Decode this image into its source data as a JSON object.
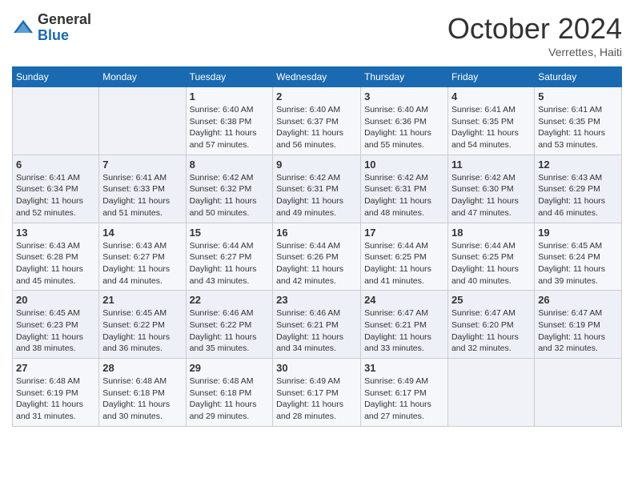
{
  "header": {
    "logo_line1": "General",
    "logo_line2": "Blue",
    "month_year": "October 2024",
    "location": "Verrettes, Haiti"
  },
  "days_of_week": [
    "Sunday",
    "Monday",
    "Tuesday",
    "Wednesday",
    "Thursday",
    "Friday",
    "Saturday"
  ],
  "weeks": [
    [
      {
        "day": "",
        "detail": ""
      },
      {
        "day": "",
        "detail": ""
      },
      {
        "day": "1",
        "detail": "Sunrise: 6:40 AM\nSunset: 6:38 PM\nDaylight: 11 hours\nand 57 minutes."
      },
      {
        "day": "2",
        "detail": "Sunrise: 6:40 AM\nSunset: 6:37 PM\nDaylight: 11 hours\nand 56 minutes."
      },
      {
        "day": "3",
        "detail": "Sunrise: 6:40 AM\nSunset: 6:36 PM\nDaylight: 11 hours\nand 55 minutes."
      },
      {
        "day": "4",
        "detail": "Sunrise: 6:41 AM\nSunset: 6:35 PM\nDaylight: 11 hours\nand 54 minutes."
      },
      {
        "day": "5",
        "detail": "Sunrise: 6:41 AM\nSunset: 6:35 PM\nDaylight: 11 hours\nand 53 minutes."
      }
    ],
    [
      {
        "day": "6",
        "detail": "Sunrise: 6:41 AM\nSunset: 6:34 PM\nDaylight: 11 hours\nand 52 minutes."
      },
      {
        "day": "7",
        "detail": "Sunrise: 6:41 AM\nSunset: 6:33 PM\nDaylight: 11 hours\nand 51 minutes."
      },
      {
        "day": "8",
        "detail": "Sunrise: 6:42 AM\nSunset: 6:32 PM\nDaylight: 11 hours\nand 50 minutes."
      },
      {
        "day": "9",
        "detail": "Sunrise: 6:42 AM\nSunset: 6:31 PM\nDaylight: 11 hours\nand 49 minutes."
      },
      {
        "day": "10",
        "detail": "Sunrise: 6:42 AM\nSunset: 6:31 PM\nDaylight: 11 hours\nand 48 minutes."
      },
      {
        "day": "11",
        "detail": "Sunrise: 6:42 AM\nSunset: 6:30 PM\nDaylight: 11 hours\nand 47 minutes."
      },
      {
        "day": "12",
        "detail": "Sunrise: 6:43 AM\nSunset: 6:29 PM\nDaylight: 11 hours\nand 46 minutes."
      }
    ],
    [
      {
        "day": "13",
        "detail": "Sunrise: 6:43 AM\nSunset: 6:28 PM\nDaylight: 11 hours\nand 45 minutes."
      },
      {
        "day": "14",
        "detail": "Sunrise: 6:43 AM\nSunset: 6:27 PM\nDaylight: 11 hours\nand 44 minutes."
      },
      {
        "day": "15",
        "detail": "Sunrise: 6:44 AM\nSunset: 6:27 PM\nDaylight: 11 hours\nand 43 minutes."
      },
      {
        "day": "16",
        "detail": "Sunrise: 6:44 AM\nSunset: 6:26 PM\nDaylight: 11 hours\nand 42 minutes."
      },
      {
        "day": "17",
        "detail": "Sunrise: 6:44 AM\nSunset: 6:25 PM\nDaylight: 11 hours\nand 41 minutes."
      },
      {
        "day": "18",
        "detail": "Sunrise: 6:44 AM\nSunset: 6:25 PM\nDaylight: 11 hours\nand 40 minutes."
      },
      {
        "day": "19",
        "detail": "Sunrise: 6:45 AM\nSunset: 6:24 PM\nDaylight: 11 hours\nand 39 minutes."
      }
    ],
    [
      {
        "day": "20",
        "detail": "Sunrise: 6:45 AM\nSunset: 6:23 PM\nDaylight: 11 hours\nand 38 minutes."
      },
      {
        "day": "21",
        "detail": "Sunrise: 6:45 AM\nSunset: 6:22 PM\nDaylight: 11 hours\nand 36 minutes."
      },
      {
        "day": "22",
        "detail": "Sunrise: 6:46 AM\nSunset: 6:22 PM\nDaylight: 11 hours\nand 35 minutes."
      },
      {
        "day": "23",
        "detail": "Sunrise: 6:46 AM\nSunset: 6:21 PM\nDaylight: 11 hours\nand 34 minutes."
      },
      {
        "day": "24",
        "detail": "Sunrise: 6:47 AM\nSunset: 6:21 PM\nDaylight: 11 hours\nand 33 minutes."
      },
      {
        "day": "25",
        "detail": "Sunrise: 6:47 AM\nSunset: 6:20 PM\nDaylight: 11 hours\nand 32 minutes."
      },
      {
        "day": "26",
        "detail": "Sunrise: 6:47 AM\nSunset: 6:19 PM\nDaylight: 11 hours\nand 32 minutes."
      }
    ],
    [
      {
        "day": "27",
        "detail": "Sunrise: 6:48 AM\nSunset: 6:19 PM\nDaylight: 11 hours\nand 31 minutes."
      },
      {
        "day": "28",
        "detail": "Sunrise: 6:48 AM\nSunset: 6:18 PM\nDaylight: 11 hours\nand 30 minutes."
      },
      {
        "day": "29",
        "detail": "Sunrise: 6:48 AM\nSunset: 6:18 PM\nDaylight: 11 hours\nand 29 minutes."
      },
      {
        "day": "30",
        "detail": "Sunrise: 6:49 AM\nSunset: 6:17 PM\nDaylight: 11 hours\nand 28 minutes."
      },
      {
        "day": "31",
        "detail": "Sunrise: 6:49 AM\nSunset: 6:17 PM\nDaylight: 11 hours\nand 27 minutes."
      },
      {
        "day": "",
        "detail": ""
      },
      {
        "day": "",
        "detail": ""
      }
    ]
  ]
}
